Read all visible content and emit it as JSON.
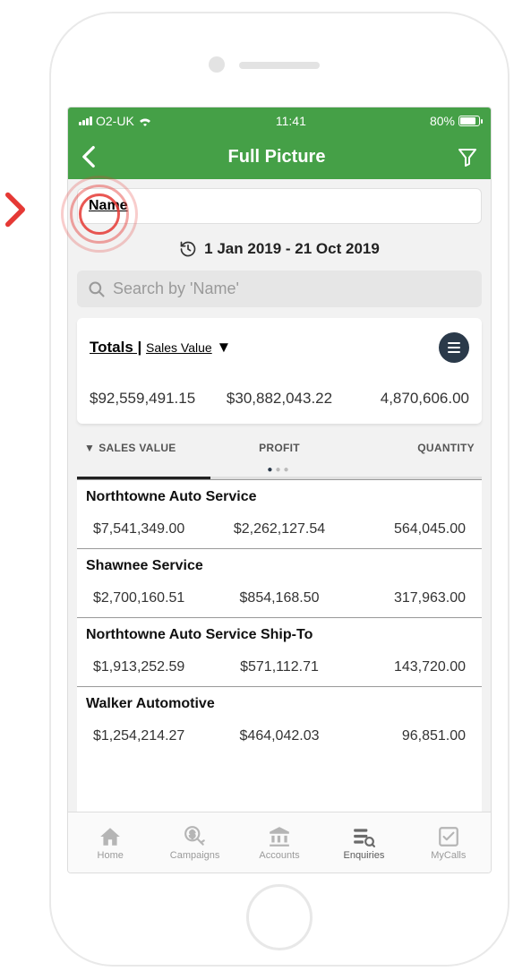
{
  "status": {
    "carrier": "O2-UK",
    "time": "11:41",
    "battery_pct": "80%"
  },
  "header": {
    "title": "Full Picture"
  },
  "filter_pill": {
    "label": "Name"
  },
  "date_range": {
    "text": "1 Jan 2019 - 21 Oct 2019"
  },
  "search": {
    "placeholder": "Search by 'Name'"
  },
  "totals": {
    "label_main": "Totals |",
    "label_sub": "Sales Value",
    "values": {
      "sales": "$92,559,491.15",
      "profit": "$30,882,043.22",
      "quantity": "4,870,606.00"
    }
  },
  "columns": {
    "c1": "SALES VALUE",
    "c2": "PROFIT",
    "c3": "QUANTITY"
  },
  "rows": [
    {
      "name": "Northtowne Auto Service",
      "sales": "$7,541,349.00",
      "profit": "$2,262,127.54",
      "qty": "564,045.00"
    },
    {
      "name": "Shawnee Service",
      "sales": "$2,700,160.51",
      "profit": "$854,168.50",
      "qty": "317,963.00"
    },
    {
      "name": "Northtowne Auto Service Ship-To",
      "sales": "$1,913,252.59",
      "profit": "$571,112.71",
      "qty": "143,720.00"
    },
    {
      "name": "Walker Automotive",
      "sales": "$1,254,214.27",
      "profit": "$464,042.03",
      "qty": "96,851.00"
    }
  ],
  "tabs": {
    "home": "Home",
    "campaigns": "Campaigns",
    "accounts": "Accounts",
    "enquiries": "Enquiries",
    "mycalls": "MyCalls"
  }
}
